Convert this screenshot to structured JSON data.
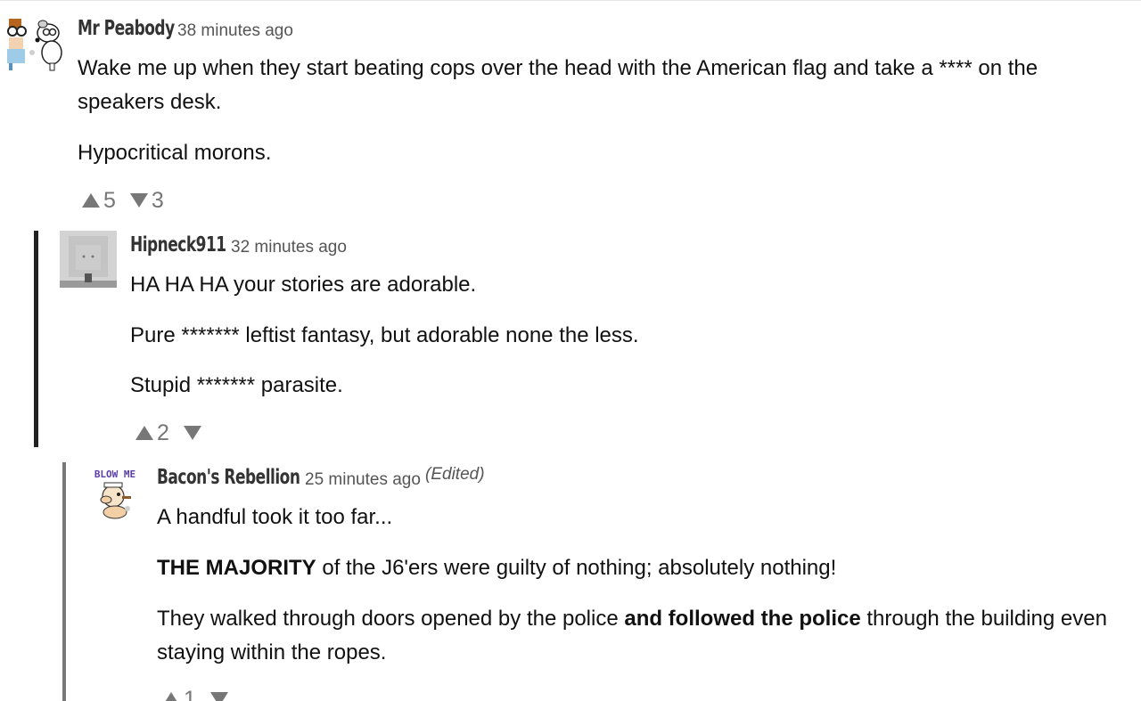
{
  "comments": [
    {
      "author": "Mr Peabody",
      "time": "38 minutes ago",
      "paragraphs": [
        "Wake me up when they start beating cops over the head with the American flag and take a **** on the speakers desk.",
        "Hypocritical morons."
      ],
      "upvotes": "5",
      "downvotes": "3",
      "avatar_icon": "cartoon-dog-and-boy-avatar-icon"
    },
    {
      "author": "Hipneck911",
      "time": "32 minutes ago",
      "paragraphs": [
        "HA HA HA your stories are adorable.",
        "Pure ******* leftist fantasy, but adorable none the less.",
        "Stupid ******* parasite."
      ],
      "upvotes": "2",
      "downvotes": "",
      "avatar_icon": "grey-box-character-avatar-icon"
    },
    {
      "author": "Bacon's Rebellion",
      "time": "25 minutes ago",
      "edited": "(Edited)",
      "avatar_caption": "BLOW ME",
      "p1": "A handful took it too far...",
      "p2_bold": "THE MAJORITY",
      "p2_rest": " of the J6'ers were guilty of nothing; absolutely nothing!",
      "p3_a": "They walked through doors opened by the police ",
      "p3_bold": "and followed the police",
      "p3_b": " through the building even staying within the ropes.",
      "upvotes": "1",
      "avatar_icon": "popeye-cartoon-avatar-icon"
    }
  ],
  "colors": {
    "thread_line_dark": "#222222",
    "thread_line_grey": "#777777",
    "vote_grey": "#777777",
    "author_grey": "#333333"
  }
}
